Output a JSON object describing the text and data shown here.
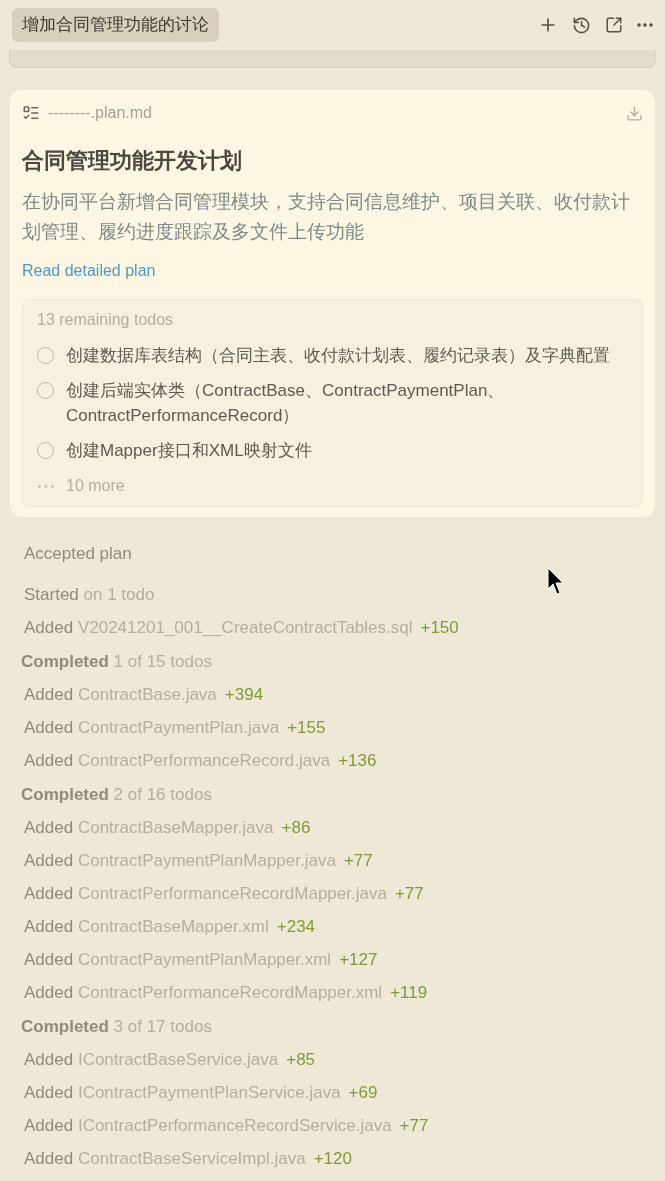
{
  "header": {
    "title": "增加合同管理功能的讨论"
  },
  "plan": {
    "filename": "--------.plan.md",
    "title": "合同管理功能开发计划",
    "description": "在协同平台新增合同管理模块，支持合同信息维护、项目关联、收付款计划管理、履约进度跟踪及多文件上传功能",
    "link": "Read detailed plan",
    "todos": {
      "heading": "13 remaining todos",
      "items": [
        {
          "text": "创建数据库表结构（合同主表、收付款计划表、履约记录表）及字典配置",
          "checked": false
        },
        {
          "text": "创建后端实体类（ContractBase、ContractPaymentPlan、ContractPerformanceRecord）",
          "checked": false
        },
        {
          "text": "创建Mapper接口和XML映射文件",
          "checked": false
        }
      ],
      "more": "10 more"
    }
  },
  "log": [
    {
      "kind": "status",
      "label": "Accepted plan"
    },
    {
      "kind": "started",
      "label": "Started",
      "detail": "on 1 todo"
    },
    {
      "kind": "added",
      "label": "Added",
      "detail": "V20241201_001__CreateContractTables.sql",
      "count": "+150"
    },
    {
      "kind": "completed",
      "label": "Completed",
      "detail": "1 of 15 todos"
    },
    {
      "kind": "added",
      "label": "Added",
      "detail": "ContractBase.java",
      "count": "+394"
    },
    {
      "kind": "added",
      "label": "Added",
      "detail": "ContractPaymentPlan.java",
      "count": "+155"
    },
    {
      "kind": "added",
      "label": "Added",
      "detail": "ContractPerformanceRecord.java",
      "count": "+136"
    },
    {
      "kind": "completed",
      "label": "Completed",
      "detail": "2 of 16 todos"
    },
    {
      "kind": "added",
      "label": "Added",
      "detail": "ContractBaseMapper.java",
      "count": "+86"
    },
    {
      "kind": "added",
      "label": "Added",
      "detail": "ContractPaymentPlanMapper.java",
      "count": "+77"
    },
    {
      "kind": "added",
      "label": "Added",
      "detail": "ContractPerformanceRecordMapper.java",
      "count": "+77"
    },
    {
      "kind": "added",
      "label": "Added",
      "detail": "ContractBaseMapper.xml",
      "count": "+234"
    },
    {
      "kind": "added",
      "label": "Added",
      "detail": "ContractPaymentPlanMapper.xml",
      "count": "+127"
    },
    {
      "kind": "added",
      "label": "Added",
      "detail": "ContractPerformanceRecordMapper.xml",
      "count": "+119"
    },
    {
      "kind": "completed",
      "label": "Completed",
      "detail": "3 of 17 todos"
    },
    {
      "kind": "added",
      "label": "Added",
      "detail": "IContractBaseService.java",
      "count": "+85"
    },
    {
      "kind": "added",
      "label": "Added",
      "detail": "IContractPaymentPlanService.java",
      "count": "+69"
    },
    {
      "kind": "added",
      "label": "Added",
      "detail": "IContractPerformanceRecordService.java",
      "count": "+77"
    },
    {
      "kind": "added",
      "label": "Added",
      "detail": "ContractBaseServiceImpl.java",
      "count": "+120"
    }
  ]
}
